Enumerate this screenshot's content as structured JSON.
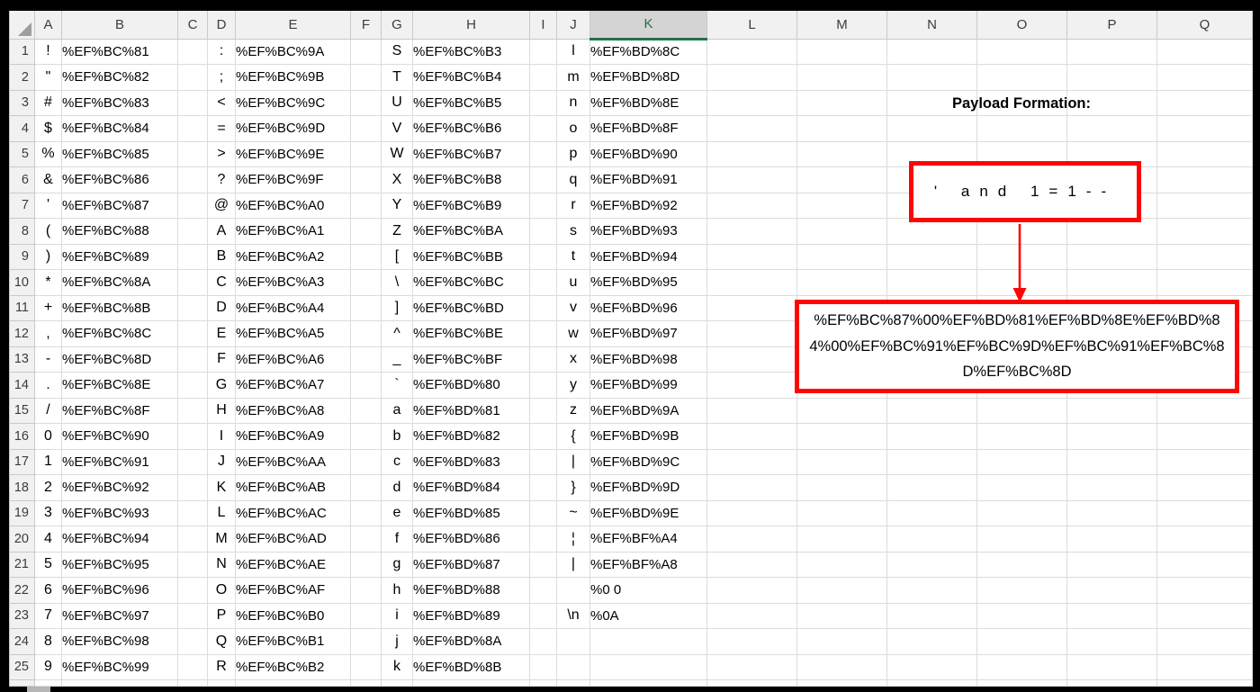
{
  "colors": {
    "red_accent": "#fe0505",
    "excel_green": "#217346"
  },
  "grid": {
    "column_headers": [
      "A",
      "B",
      "C",
      "D",
      "E",
      "F",
      "G",
      "H",
      "I",
      "J",
      "K",
      "L",
      "M",
      "N",
      "O",
      "P",
      "Q"
    ],
    "selected_column": "K",
    "rows": [
      {
        "n": "1",
        "cells": {
          "A": "!",
          "B": "%EF%BC%81",
          "D": ":",
          "E": "%EF%BC%9A",
          "G": "S",
          "H": "%EF%BC%B3",
          "J": "l",
          "K": "%EF%BD%8C"
        }
      },
      {
        "n": "2",
        "cells": {
          "A": "\"",
          "B": "%EF%BC%82",
          "D": ";",
          "E": "%EF%BC%9B",
          "G": "T",
          "H": "%EF%BC%B4",
          "J": "m",
          "K": "%EF%BD%8D"
        }
      },
      {
        "n": "3",
        "cells": {
          "A": "#",
          "B": "%EF%BC%83",
          "D": "<",
          "E": "%EF%BC%9C",
          "G": "U",
          "H": "%EF%BC%B5",
          "J": "n",
          "K": "%EF%BD%8E"
        }
      },
      {
        "n": "4",
        "cells": {
          "A": "$",
          "B": "%EF%BC%84",
          "D": "=",
          "E": "%EF%BC%9D",
          "G": "V",
          "H": "%EF%BC%B6",
          "J": "o",
          "K": "%EF%BD%8F"
        }
      },
      {
        "n": "5",
        "cells": {
          "A": "%",
          "B": "%EF%BC%85",
          "D": ">",
          "E": "%EF%BC%9E",
          "G": "W",
          "H": "%EF%BC%B7",
          "J": "p",
          "K": "%EF%BD%90"
        }
      },
      {
        "n": "6",
        "cells": {
          "A": "&",
          "B": "%EF%BC%86",
          "D": "?",
          "E": "%EF%BC%9F",
          "G": "X",
          "H": "%EF%BC%B8",
          "J": "q",
          "K": "%EF%BD%91"
        }
      },
      {
        "n": "7",
        "cells": {
          "A": "'",
          "B": "%EF%BC%87",
          "D": "@",
          "E": "%EF%BC%A0",
          "G": "Y",
          "H": "%EF%BC%B9",
          "J": "r",
          "K": "%EF%BD%92"
        }
      },
      {
        "n": "8",
        "cells": {
          "A": "(",
          "B": "%EF%BC%88",
          "D": "A",
          "E": "%EF%BC%A1",
          "G": "Z",
          "H": "%EF%BC%BA",
          "J": "s",
          "K": "%EF%BD%93"
        }
      },
      {
        "n": "9",
        "cells": {
          "A": ")",
          "B": "%EF%BC%89",
          "D": "B",
          "E": "%EF%BC%A2",
          "G": "[",
          "H": "%EF%BC%BB",
          "J": "t",
          "K": "%EF%BD%94"
        }
      },
      {
        "n": "10",
        "cells": {
          "A": "*",
          "B": "%EF%BC%8A",
          "D": "C",
          "E": "%EF%BC%A3",
          "G": "\\",
          "H": "%EF%BC%BC",
          "J": "u",
          "K": "%EF%BD%95"
        }
      },
      {
        "n": "11",
        "cells": {
          "A": "+",
          "B": "%EF%BC%8B",
          "D": "D",
          "E": "%EF%BC%A4",
          "G": "]",
          "H": "%EF%BC%BD",
          "J": "v",
          "K": "%EF%BD%96"
        }
      },
      {
        "n": "12",
        "cells": {
          "A": ",",
          "B": "%EF%BC%8C",
          "D": "E",
          "E": "%EF%BC%A5",
          "G": "^",
          "H": "%EF%BC%BE",
          "J": "w",
          "K": "%EF%BD%97"
        }
      },
      {
        "n": "13",
        "cells": {
          "A": "-",
          "B": "%EF%BC%8D",
          "D": "F",
          "E": "%EF%BC%A6",
          "G": "_",
          "H": "%EF%BC%BF",
          "J": "x",
          "K": "%EF%BD%98"
        }
      },
      {
        "n": "14",
        "cells": {
          "A": ".",
          "B": "%EF%BC%8E",
          "D": "G",
          "E": "%EF%BC%A7",
          "G": "`",
          "H": "%EF%BD%80",
          "J": "y",
          "K": "%EF%BD%99"
        }
      },
      {
        "n": "15",
        "cells": {
          "A": "/",
          "B": "%EF%BC%8F",
          "D": "H",
          "E": "%EF%BC%A8",
          "G": "a",
          "H": "%EF%BD%81",
          "J": "z",
          "K": "%EF%BD%9A"
        }
      },
      {
        "n": "16",
        "cells": {
          "A": "0",
          "B": "%EF%BC%90",
          "D": "I",
          "E": "%EF%BC%A9",
          "G": "b",
          "H": "%EF%BD%82",
          "J": "{",
          "K": "%EF%BD%9B"
        }
      },
      {
        "n": "17",
        "cells": {
          "A": "1",
          "B": "%EF%BC%91",
          "D": "J",
          "E": "%EF%BC%AA",
          "G": "c",
          "H": "%EF%BD%83",
          "J": "|",
          "K": "%EF%BD%9C"
        }
      },
      {
        "n": "18",
        "cells": {
          "A": "2",
          "B": "%EF%BC%92",
          "D": "K",
          "E": "%EF%BC%AB",
          "G": "d",
          "H": "%EF%BD%84",
          "J": "}",
          "K": "%EF%BD%9D"
        }
      },
      {
        "n": "19",
        "cells": {
          "A": "3",
          "B": "%EF%BC%93",
          "D": "L",
          "E": "%EF%BC%AC",
          "G": "e",
          "H": "%EF%BD%85",
          "J": "~",
          "K": "%EF%BD%9E"
        }
      },
      {
        "n": "20",
        "cells": {
          "A": "4",
          "B": "%EF%BC%94",
          "D": "M",
          "E": "%EF%BC%AD",
          "G": "f",
          "H": "%EF%BD%86",
          "J": "¦",
          "K": "%EF%BF%A4"
        }
      },
      {
        "n": "21",
        "cells": {
          "A": "5",
          "B": "%EF%BC%95",
          "D": "N",
          "E": "%EF%BC%AE",
          "G": "g",
          "H": "%EF%BD%87",
          "J": "|",
          "K": "%EF%BF%A8"
        }
      },
      {
        "n": "22",
        "cells": {
          "A": "6",
          "B": "%EF%BC%96",
          "D": "O",
          "E": "%EF%BC%AF",
          "G": "h",
          "H": "%EF%BD%88",
          "J": "",
          "K": "%0 0"
        }
      },
      {
        "n": "23",
        "cells": {
          "A": "7",
          "B": "%EF%BC%97",
          "D": "P",
          "E": "%EF%BC%B0",
          "G": "i",
          "H": "%EF%BD%89",
          "J": "\\n",
          "K": "%0A"
        }
      },
      {
        "n": "24",
        "cells": {
          "A": "8",
          "B": "%EF%BC%98",
          "D": "Q",
          "E": "%EF%BC%B1",
          "G": "j",
          "H": "%EF%BD%8A"
        }
      },
      {
        "n": "25",
        "cells": {
          "A": "9",
          "B": "%EF%BC%99",
          "D": "R",
          "E": "%EF%BC%B2",
          "G": "k",
          "H": "%EF%BD%8B"
        }
      }
    ]
  },
  "annotation": {
    "title": "Payload Formation:",
    "payload_plain": "' and 1=1--",
    "payload_encoded": "%EF%BC%87%00%EF%BD%81%EF%BD%8E%EF%BD%84%00%EF%BC%91%EF%BC%9D%EF%BC%91%EF%BC%8D%EF%BC%8D"
  }
}
